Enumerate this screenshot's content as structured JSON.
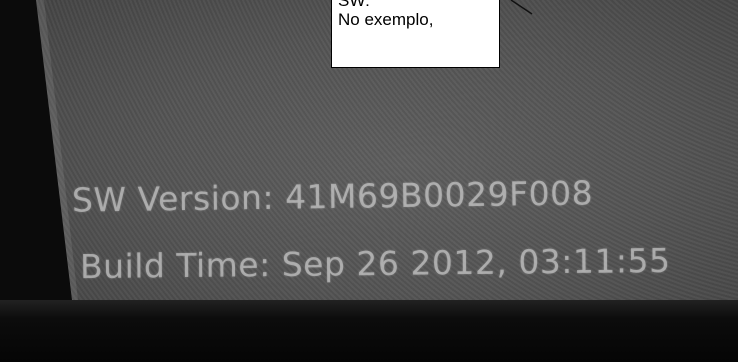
{
  "callout": {
    "lines": [
      "SW:",
      "No exemplo,"
    ]
  },
  "screen": {
    "sw_version": "SW Version: 41M69B0029F008",
    "build_time": "Build Time: Sep 26 2012, 03:11:55"
  }
}
